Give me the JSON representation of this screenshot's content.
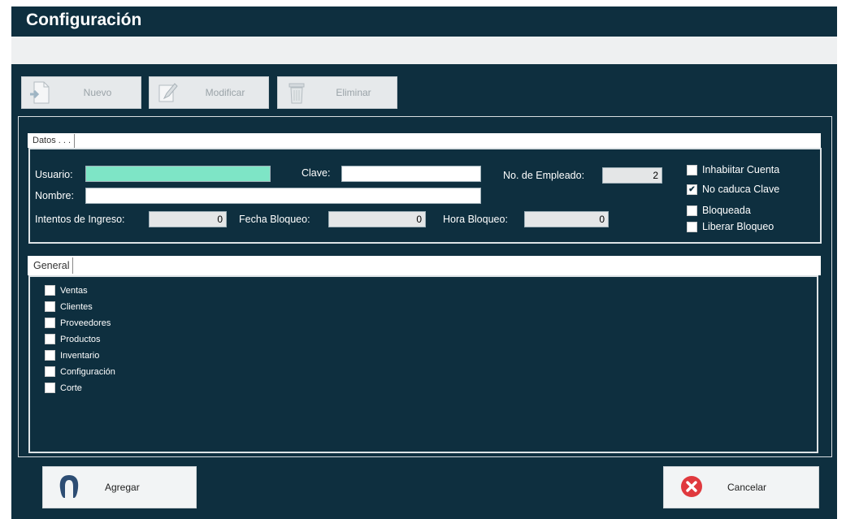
{
  "window": {
    "title": "Configuración"
  },
  "toolbar": {
    "nuevo": "Nuevo",
    "modificar": "Modificar",
    "eliminar": "Eliminar"
  },
  "datos": {
    "tab_label": "Datos . . .",
    "usuario_label": "Usuario:",
    "usuario_value": "",
    "clave_label": "Clave:",
    "clave_value": "",
    "empleado_label": "No. de Empleado:",
    "empleado_value": "2",
    "nombre_label": "Nombre:",
    "nombre_value": "",
    "intentos_label": "Intentos de Ingreso:",
    "intentos_value": "0",
    "fecha_label": "Fecha Bloqueo:",
    "fecha_value": "0",
    "hora_label": "Hora Bloqueo:",
    "hora_value": "0",
    "options": [
      {
        "label": "Inhabiitar Cuenta",
        "checked": false
      },
      {
        "label": "No caduca Clave",
        "checked": true
      },
      {
        "label": "Bloqueada",
        "checked": false
      },
      {
        "label": "Liberar Bloqueo",
        "checked": false
      }
    ]
  },
  "general": {
    "tab_label": "General",
    "permissions": [
      {
        "label": "Ventas",
        "checked": false
      },
      {
        "label": "Clientes",
        "checked": false
      },
      {
        "label": "Proveedores",
        "checked": false
      },
      {
        "label": "Productos",
        "checked": false
      },
      {
        "label": "Inventario",
        "checked": false
      },
      {
        "label": "Configuración",
        "checked": false
      },
      {
        "label": "Corte",
        "checked": false
      }
    ]
  },
  "footer": {
    "agregar": "Agregar",
    "cancelar": "Cancelar"
  },
  "colors": {
    "background": "#0e2f3f",
    "focused_input": "#7ee5c6",
    "cancel_icon": "#e0393e",
    "user_icon": "#2d4d73"
  }
}
